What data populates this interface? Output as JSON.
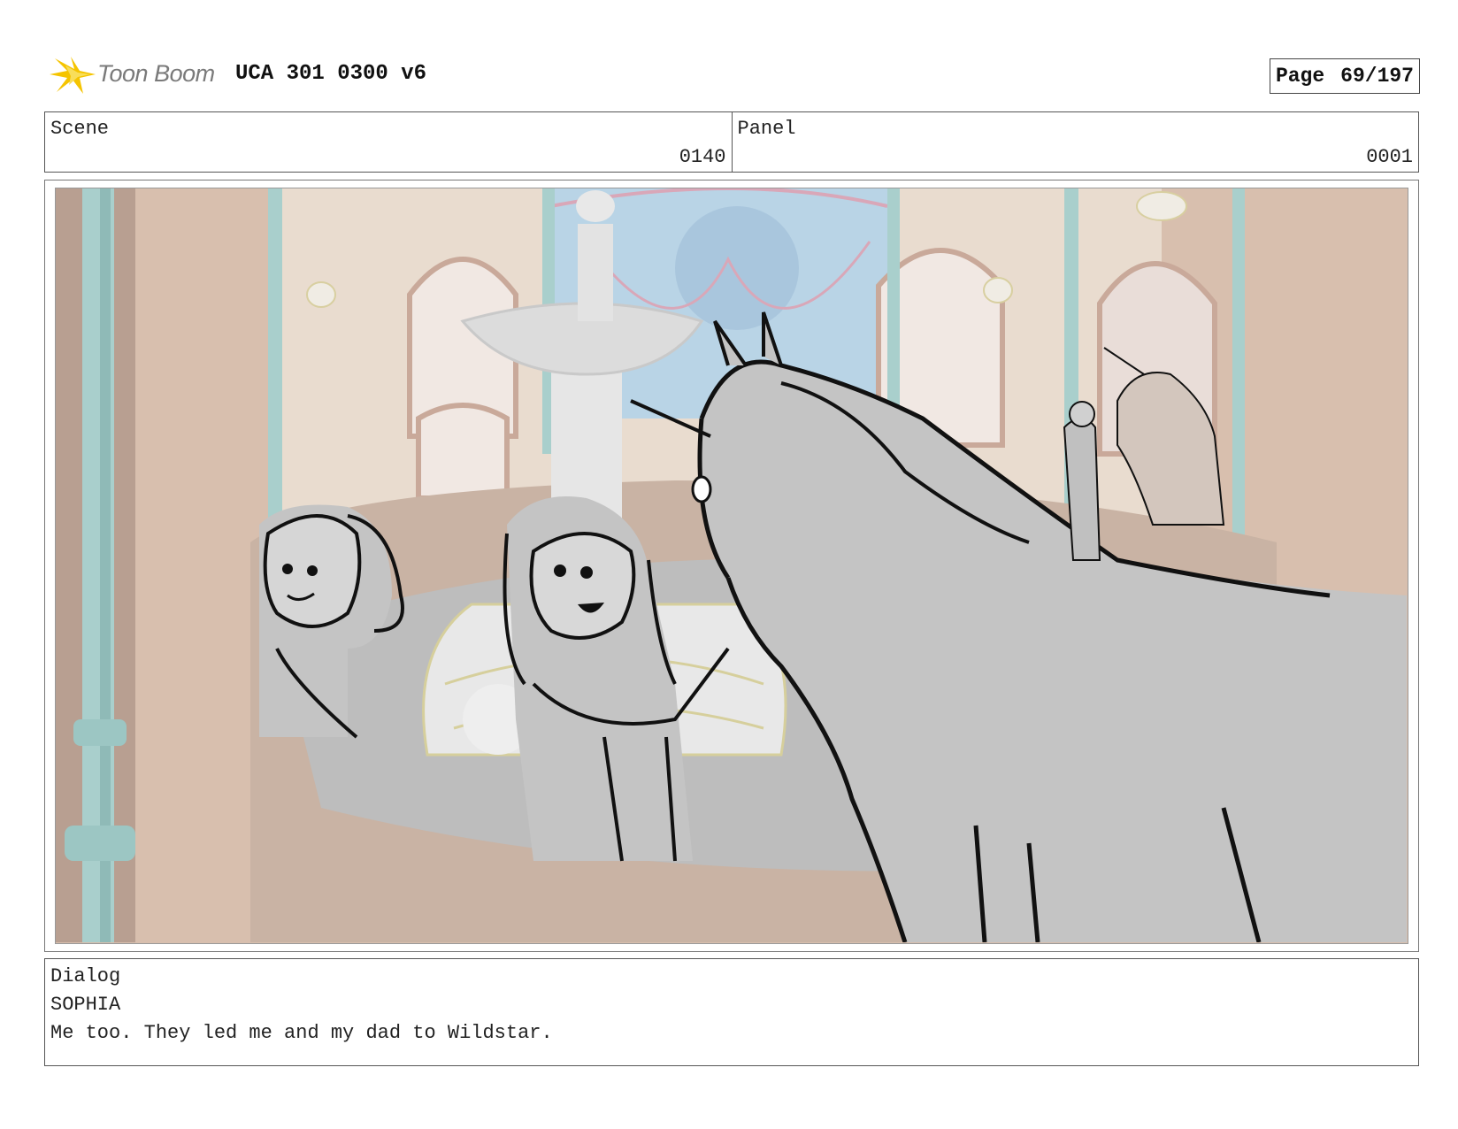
{
  "header": {
    "logo_text": "Toon Boom",
    "title": "UCA 301 0300 v6",
    "page_label": "Page",
    "page_value": "69/197"
  },
  "scene": {
    "label": "Scene",
    "value": "0140"
  },
  "panel": {
    "label": "Panel",
    "value": "0001"
  },
  "dialog": {
    "label": "Dialog",
    "speaker": "SOPHIA",
    "line": "Me too. They led me and my dad to Wildstar."
  },
  "colors": {
    "wall": "#d8bfae",
    "pillar": "#a9cfcc",
    "sky": "#b9d4e6",
    "fountain": "#e8e8e8",
    "sketch_fill": "#c4c4c4",
    "logo_yellow": "#f5c400"
  }
}
